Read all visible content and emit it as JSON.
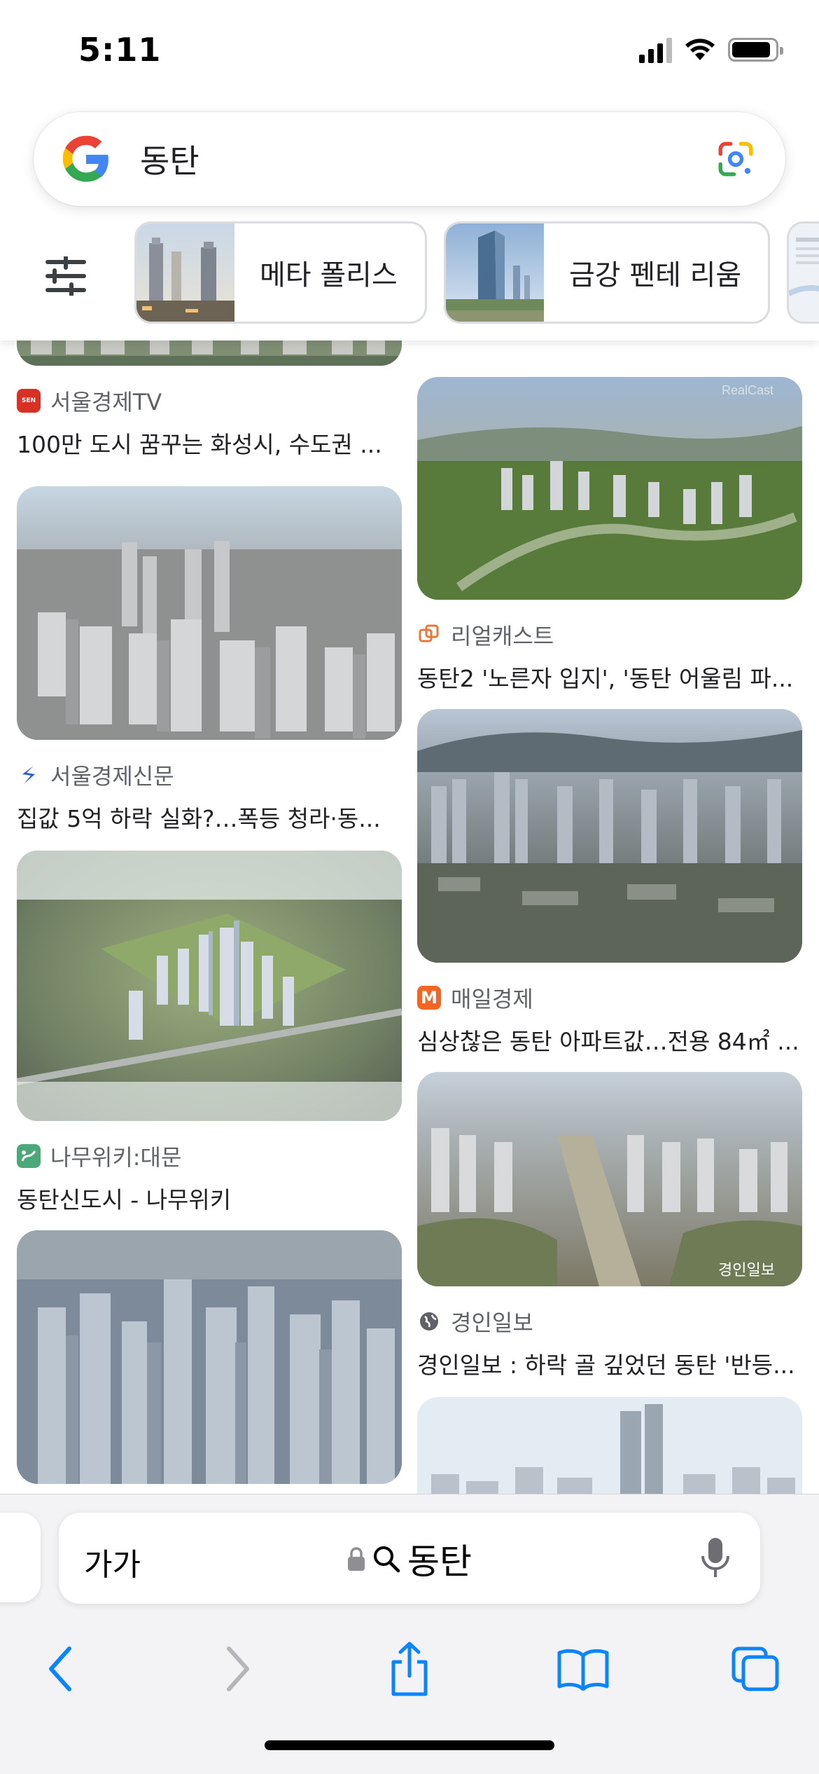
{
  "status_bar": {
    "time": "5:11"
  },
  "search": {
    "query": "동탄"
  },
  "chips": [
    {
      "label": "메타 폴리스"
    },
    {
      "label": "금강 펜테 리움"
    }
  ],
  "results": {
    "left_column": [
      {
        "source": "서울경제TV",
        "title": "100만 도시 꿈꾸는 화성시, 수도권 ..."
      },
      {
        "source": "서울경제신문",
        "title": "집값 5억 하락 실화?…폭등 청라·동..."
      },
      {
        "source": "나무위키:대문",
        "title": "동탄신도시 - 나무위키"
      }
    ],
    "right_column": [
      {
        "source": "리얼캐스트",
        "title": "동탄2 '노른자 입지', '동탄 어울림 파..."
      },
      {
        "source": "매일경제",
        "title": "심상찮은 동탄 아파트값…전용 84㎡ ..."
      },
      {
        "source": "경인일보",
        "title": "경인일보 : 하락 골 깊었던 동탄 '반등..."
      }
    ],
    "image_watermarks": {
      "realcast": "RealCast",
      "kyeongin": "경인일보"
    }
  },
  "safari": {
    "text_size_label": "가가",
    "url": "동탄",
    "toolbar": [
      "back",
      "forward",
      "share",
      "bookmarks",
      "tabs"
    ]
  },
  "colors": {
    "ios_blue": "#0a84ff",
    "google_blue": "#4285F4",
    "google_red": "#EA4335",
    "google_yellow": "#FBBC05",
    "google_green": "#34A853"
  }
}
